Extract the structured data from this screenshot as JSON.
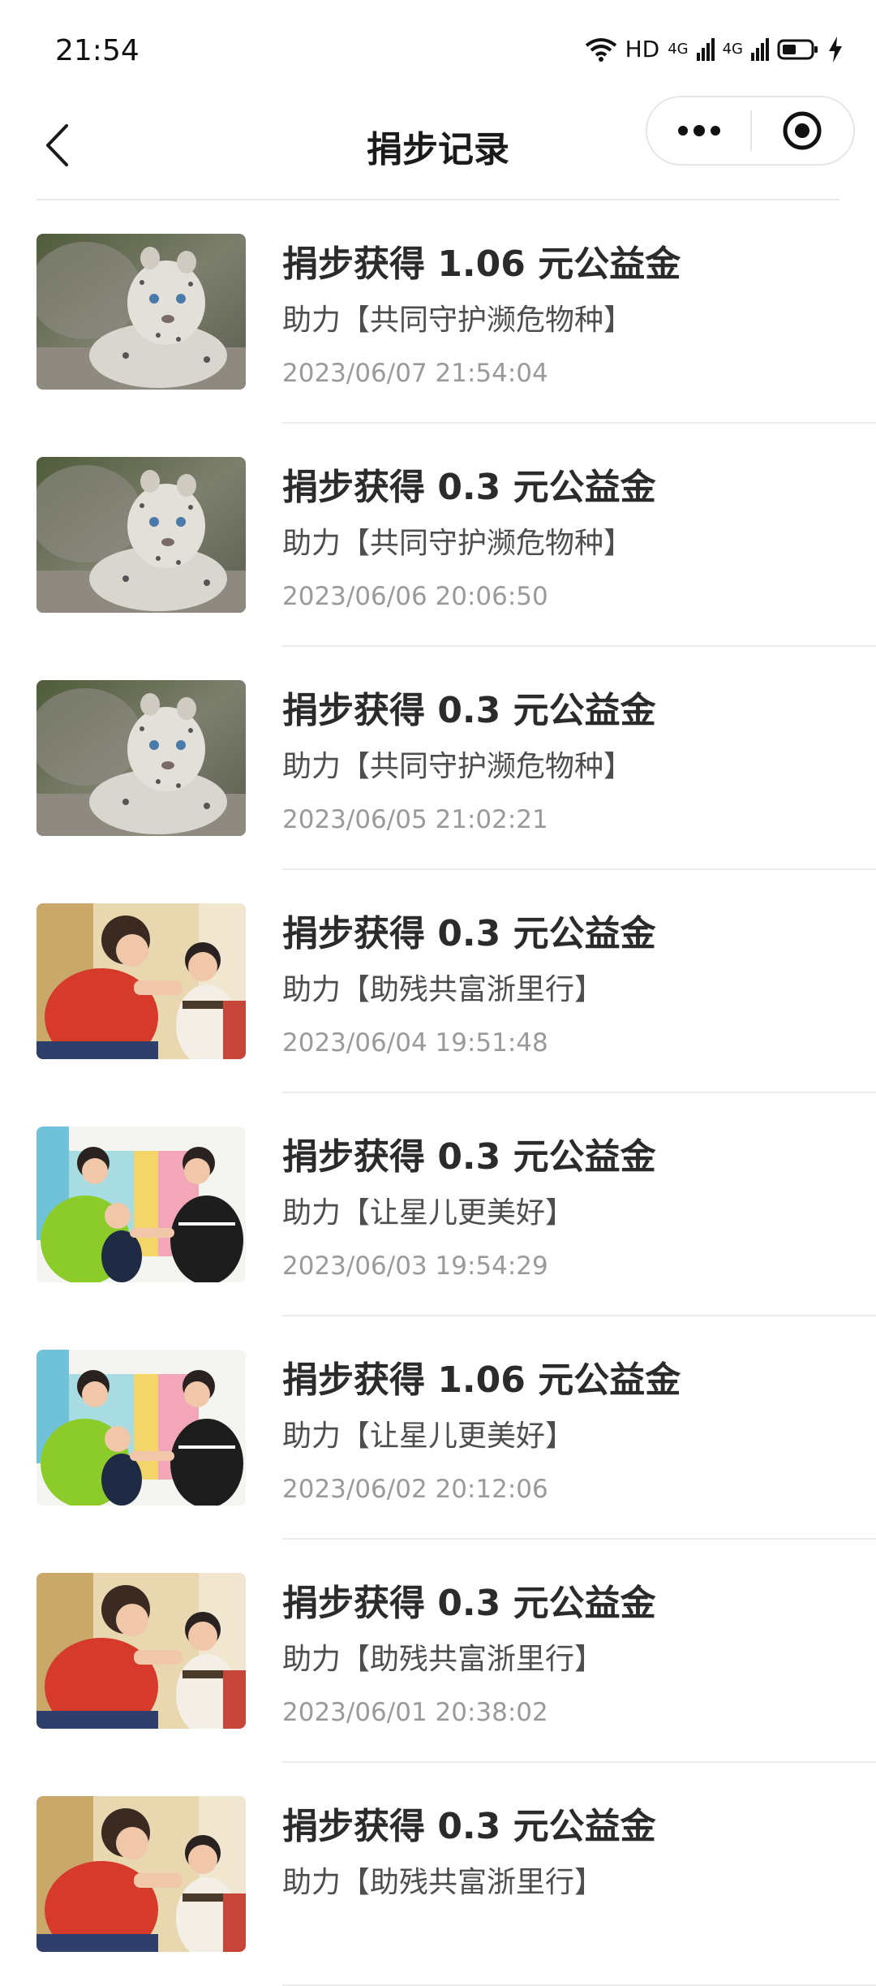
{
  "status_bar": {
    "time": "21:54",
    "network_label": "HD",
    "signal_1": "4G",
    "signal_2": "4G"
  },
  "navbar": {
    "title": "捐步记录"
  },
  "records": [
    {
      "title": "捐步获得 1.06 元公益金",
      "project": "助力【共同守护濒危物种】",
      "time": "2023/06/07 21:54:04",
      "image": "snow-leopard-image"
    },
    {
      "title": "捐步获得 0.3 元公益金",
      "project": "助力【共同守护濒危物种】",
      "time": "2023/06/06 20:06:50",
      "image": "snow-leopard-image"
    },
    {
      "title": "捐步获得 0.3 元公益金",
      "project": "助力【共同守护濒危物种】",
      "time": "2023/06/05 21:02:21",
      "image": "snow-leopard-image"
    },
    {
      "title": "捐步获得 0.3 元公益金",
      "project": "助力【助残共富浙里行】",
      "time": "2023/06/04 19:51:48",
      "image": "volunteer-child-image"
    },
    {
      "title": "捐步获得 0.3 元公益金",
      "project": "助力【让星儿更美好】",
      "time": "2023/06/03 19:54:29",
      "image": "teachers-child-image"
    },
    {
      "title": "捐步获得 1.06 元公益金",
      "project": "助力【让星儿更美好】",
      "time": "2023/06/02 20:12:06",
      "image": "teachers-child-image"
    },
    {
      "title": "捐步获得 0.3 元公益金",
      "project": "助力【助残共富浙里行】",
      "time": "2023/06/01 20:38:02",
      "image": "volunteer-child-image"
    },
    {
      "title": "捐步获得 0.3 元公益金",
      "project": "助力【助残共富浙里行】",
      "time": "",
      "image": "volunteer-child-image"
    }
  ]
}
